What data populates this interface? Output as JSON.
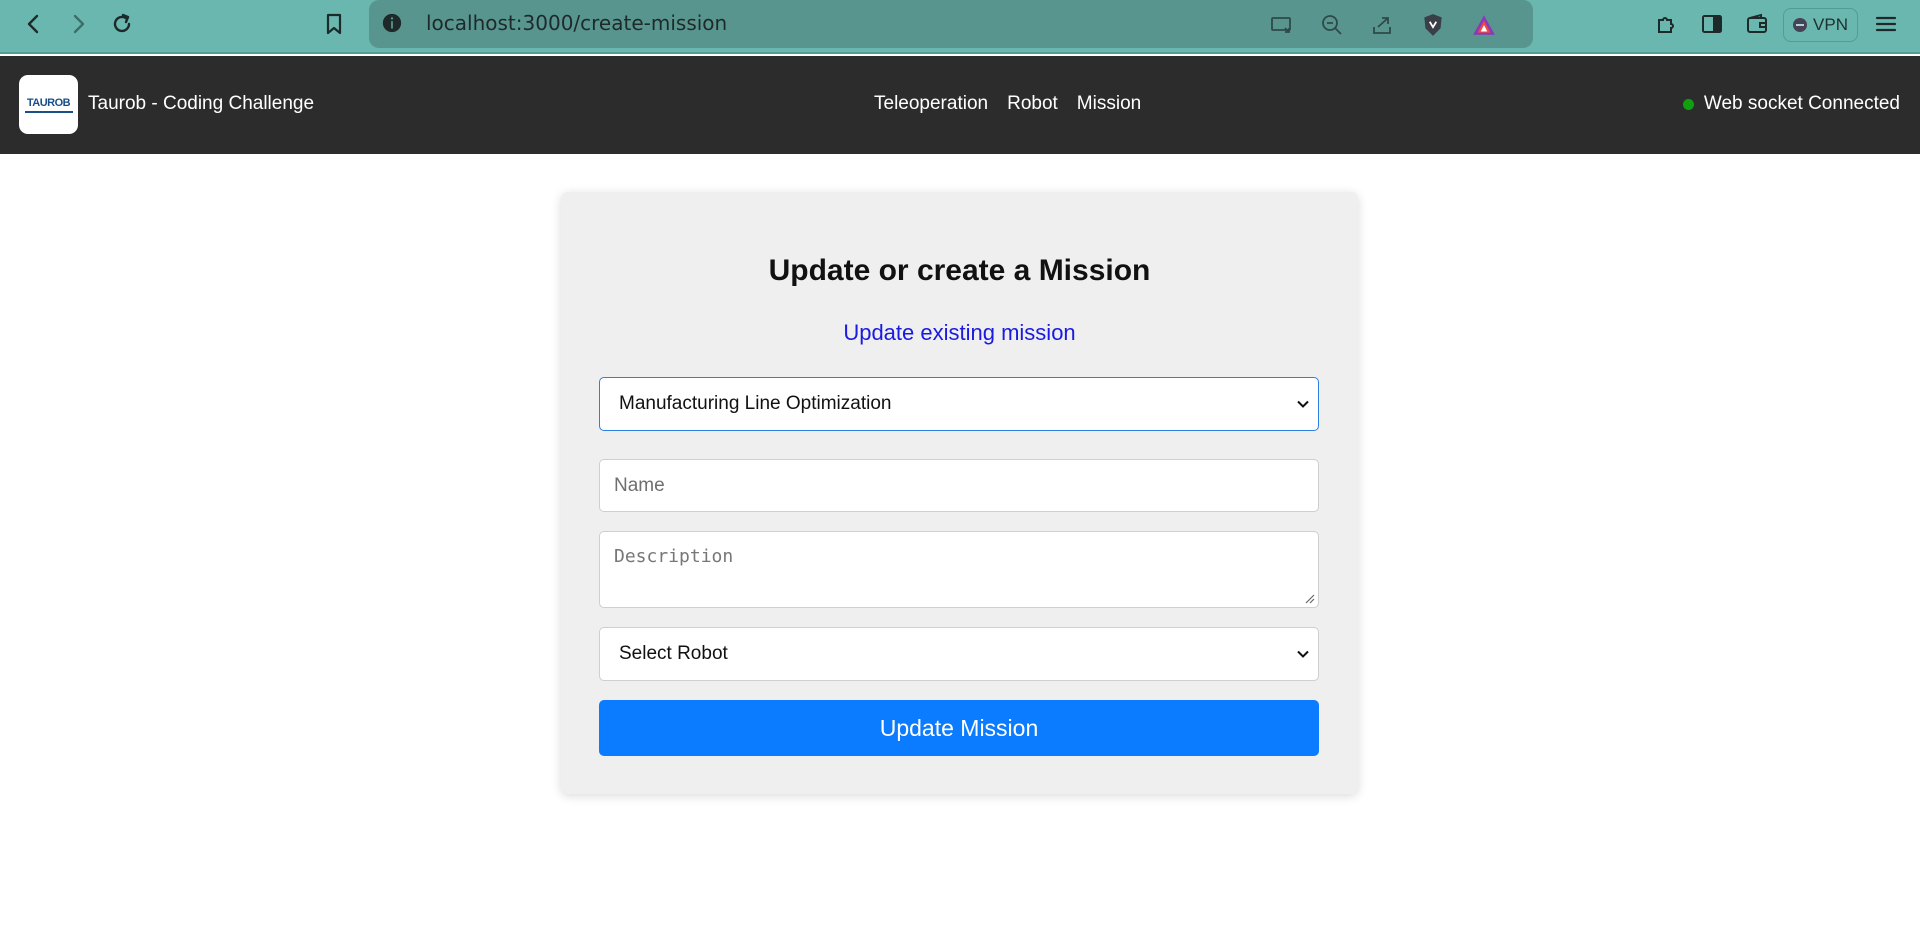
{
  "browser": {
    "url": "localhost:3000/create-mission",
    "vpn_label": "VPN",
    "accent_color": "#6ab7b0"
  },
  "header": {
    "logo_text": "TAUROB",
    "brand_title": "Taurob - Coding Challenge",
    "nav": [
      "Teleoperation",
      "Robot",
      "Mission"
    ],
    "ws_status": "Web socket Connected",
    "ws_status_color": "#0fa00f",
    "background_color": "#2c2c2c"
  },
  "form": {
    "title": "Update or create a Mission",
    "mode_link": "Update existing mission",
    "mission_select_value": "Manufacturing Line Optimization",
    "name_placeholder": "Name",
    "description_placeholder": "Description",
    "robot_select_value": "Select Robot",
    "submit_label": "Update Mission",
    "submit_color": "#0b7bff"
  }
}
